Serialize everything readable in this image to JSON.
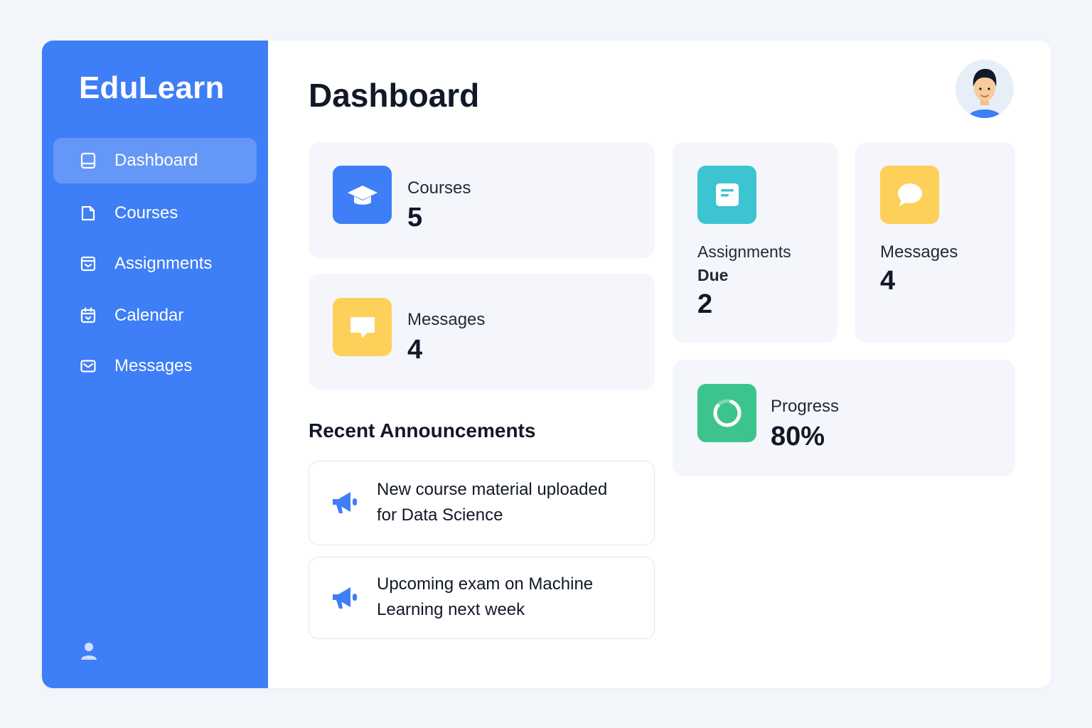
{
  "app": {
    "name": "EduLearn",
    "accent": "#3e7ef6"
  },
  "sidebar": {
    "items": [
      {
        "label": "Dashboard",
        "icon": "book-icon",
        "active": true
      },
      {
        "label": "Courses",
        "icon": "document-icon",
        "active": false
      },
      {
        "label": "Assignments",
        "icon": "inbox-icon",
        "active": false
      },
      {
        "label": "Calendar",
        "icon": "calendar-icon",
        "active": false
      },
      {
        "label": "Messages",
        "icon": "mail-icon",
        "active": false
      }
    ],
    "footer_icon": "user-icon"
  },
  "header": {
    "title": "Dashboard",
    "avatar_icon": "avatar"
  },
  "stats": {
    "courses": {
      "label": "Courses",
      "value": "5",
      "icon": "graduation-cap-icon",
      "color": "#3e7ef6"
    },
    "messages_wide": {
      "label": "Messages",
      "value": "4",
      "icon": "chat-bubble-icon",
      "color": "#fdd05a"
    },
    "assignments": {
      "label_line1": "Assignments",
      "label_line2": "Due",
      "value": "2",
      "icon": "notes-icon",
      "color": "#3cc4d0"
    },
    "messages_small": {
      "label": "Messages",
      "value": "4",
      "icon": "speech-bubble-icon",
      "color": "#fdd05a"
    },
    "progress": {
      "label": "Progress",
      "value": "80%",
      "fraction": 0.8,
      "icon": "progress-ring-icon",
      "color": "#3cc48c"
    }
  },
  "announcements": {
    "title": "Recent Announcements",
    "items": [
      {
        "line1": "New course material uploaded",
        "line2": "for Data Science",
        "icon": "megaphone-icon"
      },
      {
        "line1": "Upcoming exam on Machine",
        "line2": "Learning next week",
        "icon": "megaphone-icon"
      }
    ]
  }
}
